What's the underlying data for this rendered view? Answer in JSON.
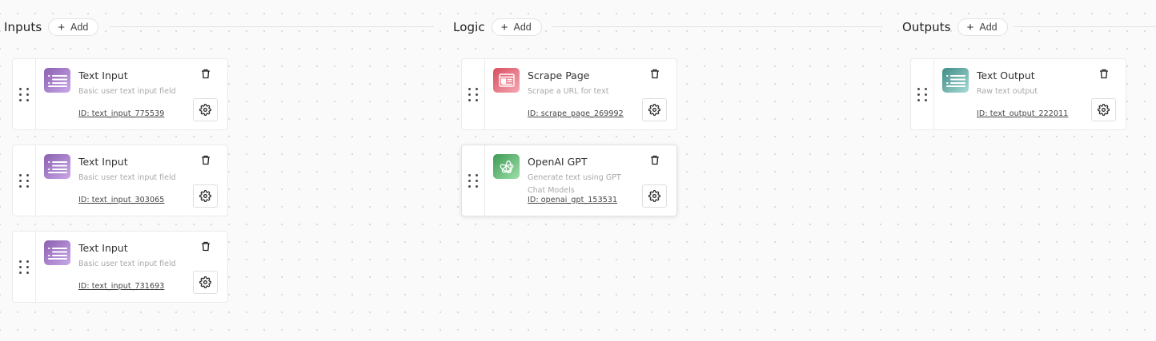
{
  "columns": {
    "inputs": {
      "title": "Inputs",
      "add_label": "Add"
    },
    "logic": {
      "title": "Logic",
      "add_label": "Add"
    },
    "outputs": {
      "title": "Outputs",
      "add_label": "Add"
    }
  },
  "inputs_nodes": [
    {
      "title": "Text Input",
      "description": "Basic user text input field",
      "id_text": "ID: text_input_775539",
      "icon": "text-lines-icon",
      "color": "#9b6cc4"
    },
    {
      "title": "Text Input",
      "description": "Basic user text input field",
      "id_text": "ID: text_input_303065",
      "icon": "text-lines-icon",
      "color": "#9b6cc4"
    },
    {
      "title": "Text Input",
      "description": "Basic user text input field",
      "id_text": "ID: text_input_731693",
      "icon": "text-lines-icon",
      "color": "#9b6cc4"
    }
  ],
  "logic_nodes": [
    {
      "title": "Scrape Page",
      "description": "Scrape a URL for text",
      "id_text": "ID: scrape_page_269992",
      "icon": "browser-page-icon",
      "color": "#e36675"
    },
    {
      "title": "OpenAI GPT",
      "description": "Generate text using GPT Chat Models",
      "id_text": "ID: openai_gpt_153531",
      "icon": "openai-logo-icon",
      "color": "#5bb36e"
    }
  ],
  "outputs_nodes": [
    {
      "title": "Text Output",
      "description": "Raw text output",
      "id_text": "ID: text_output_222011",
      "icon": "text-lines-icon",
      "color": "#6bb0a9"
    }
  ],
  "actions": {
    "delete_icon": "trash-icon",
    "settings_icon": "gear-icon",
    "drag_icon": "drag-handle-icon",
    "add_icon": "plus-icon"
  }
}
